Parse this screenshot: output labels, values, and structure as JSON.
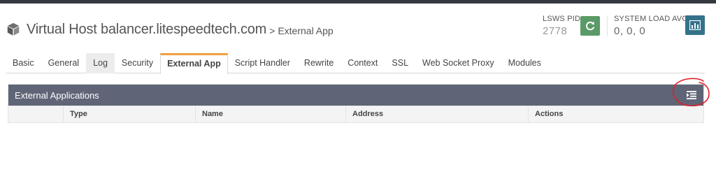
{
  "header": {
    "title": "Virtual Host balancer.litespeedtech.com",
    "separator": ">",
    "subtitle": "External App",
    "icon": "cube-icon"
  },
  "stats": {
    "pid_label": "LSWS PID",
    "pid_value": "2778",
    "load_label": "SYSTEM LOAD AVG",
    "load_value": "0, 0, 0",
    "restart_icon": "refresh-icon",
    "load_icon": "bar-chart-icon",
    "restart_color": "#5a9a66",
    "load_color": "#33728a"
  },
  "tabs": [
    {
      "label": "Basic"
    },
    {
      "label": "General"
    },
    {
      "label": "Log"
    },
    {
      "label": "Security"
    },
    {
      "label": "External App"
    },
    {
      "label": "Script Handler"
    },
    {
      "label": "Rewrite"
    },
    {
      "label": "Context"
    },
    {
      "label": "SSL"
    },
    {
      "label": "Web Socket Proxy"
    },
    {
      "label": "Modules"
    }
  ],
  "active_tab": "External App",
  "panel": {
    "title": "External Applications",
    "add_icon": "add-list-icon",
    "header_color": "#5f6576",
    "columns": [
      "",
      "Type",
      "Name",
      "Address",
      "Actions"
    ]
  },
  "colors": {
    "active_tab_accent": "#f0a040",
    "annotation": "#e0202a"
  }
}
